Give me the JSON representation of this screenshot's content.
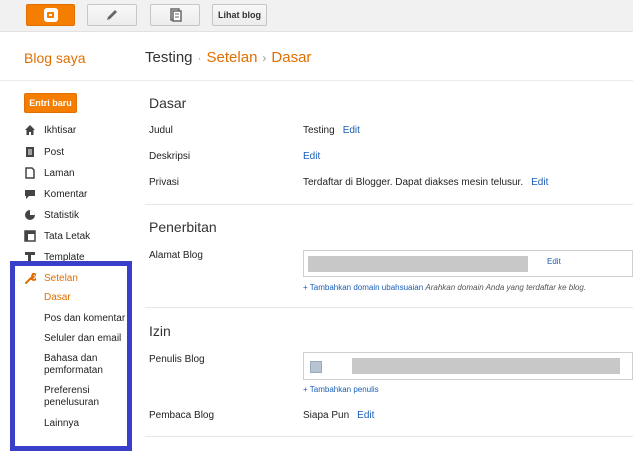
{
  "toolbar": {
    "buttons": [
      {
        "name": "blogger-home",
        "icon": "blogger-logo-icon"
      },
      {
        "name": "new-post",
        "icon": "pencil-icon"
      },
      {
        "name": "pages",
        "icon": "pages-icon"
      }
    ],
    "view_blog_label": "Lihat blog"
  },
  "header": {
    "blog_list_label": "Blog saya",
    "breadcrumb": {
      "blog_name": "Testing",
      "separator1": "·",
      "section": "Setelan",
      "separator2": "›",
      "page": "Dasar"
    }
  },
  "sidebar": {
    "new_post_label": "Entri baru",
    "items": [
      {
        "label": "Ikhtisar",
        "icon": "home-icon"
      },
      {
        "label": "Post",
        "icon": "post-icon"
      },
      {
        "label": "Laman",
        "icon": "page-icon"
      },
      {
        "label": "Komentar",
        "icon": "comment-icon"
      },
      {
        "label": "Statistik",
        "icon": "pie-chart-icon"
      },
      {
        "label": "Tata Letak",
        "icon": "layout-icon"
      },
      {
        "label": "Template",
        "icon": "template-icon"
      },
      {
        "label": "Setelan",
        "icon": "wrench-icon"
      }
    ],
    "settings_sub": [
      "Dasar",
      "Pos dan komentar",
      "Seluler dan email",
      "Bahasa dan pemformatan",
      "Preferensi penelusuran",
      "Lainnya"
    ]
  },
  "main": {
    "dasar": {
      "title": "Dasar",
      "rows": [
        {
          "label": "Judul",
          "value": "Testing",
          "action": "Edit"
        },
        {
          "label": "Deskripsi",
          "value": "",
          "action": "Edit"
        },
        {
          "label": "Privasi",
          "value": "Terdaftar di Blogger. Dapat diakses mesin telusur.",
          "action": "Edit"
        }
      ]
    },
    "penerbitan": {
      "title": "Penerbitan",
      "address_label": "Alamat Blog",
      "address_edit": "Edit",
      "add_domain_link": "+ Tambahkan domain ubahsuaian",
      "add_domain_hint": "Arahkan domain Anda yang terdaftar ke blog."
    },
    "izin": {
      "title": "Izin",
      "authors_label": "Penulis Blog",
      "add_author_link": "+ Tambahkan penulis",
      "readers_label": "Pembaca Blog",
      "readers_value": "Siapa Pun",
      "readers_action": "Edit"
    }
  },
  "colors": {
    "accent": "#f57d00",
    "link": "#1a5eb6",
    "highlight_border": "#3a3fc9"
  }
}
